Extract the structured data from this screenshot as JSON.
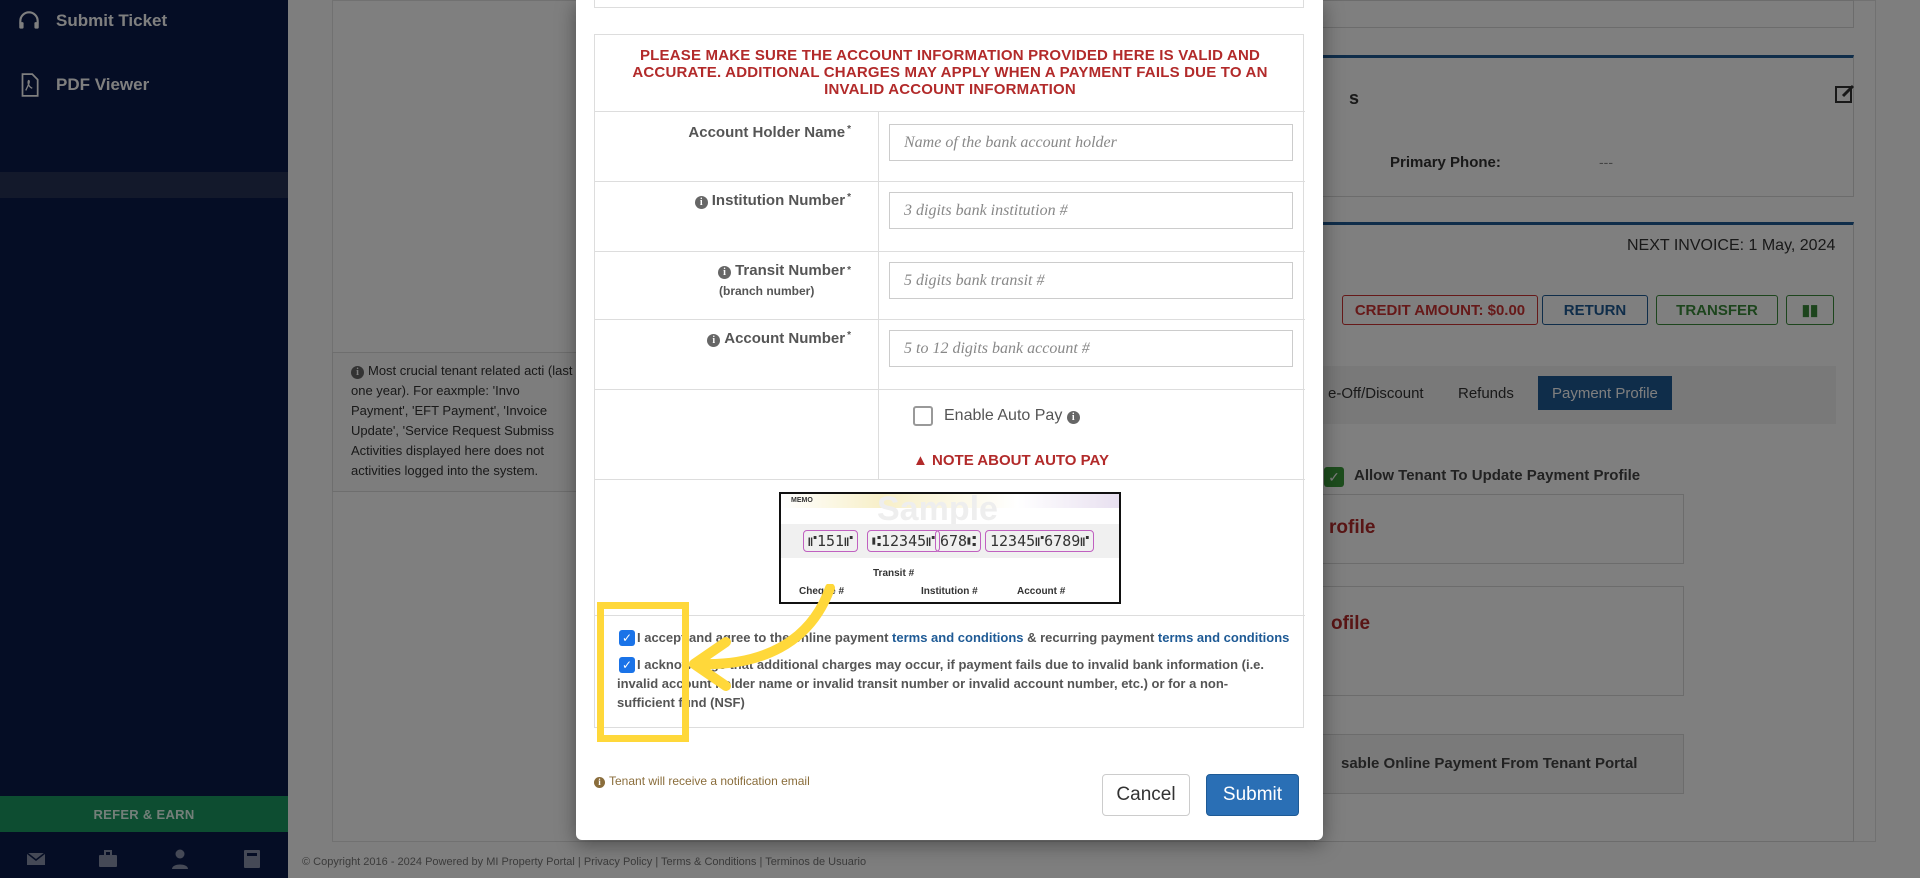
{
  "sidebar": {
    "items": [
      {
        "label": "Submit Ticket",
        "icon": "headset-icon"
      },
      {
        "label": "PDF Viewer",
        "icon": "pdf-icon"
      }
    ],
    "refer_label": "REFER & EARN",
    "bottom_icons": [
      "mail-icon",
      "briefcase-icon",
      "user-icon",
      "calculator-icon"
    ]
  },
  "background": {
    "primary_phone_label": "Primary Phone:",
    "primary_phone_value": "---",
    "next_invoice": "NEXT INVOICE: 1 May, 2024",
    "credit_amount": "CREDIT AMOUNT: $0.00",
    "return_label": "RETURN",
    "transfer_label": "TRANSFER",
    "tabs": [
      "e-Off/Discount",
      "Refunds",
      "Payment Profile"
    ],
    "allow_update_label": "Allow Tenant To Update Payment Profile",
    "profile_heading_1": "rofile",
    "profile_heading_2": "ofile",
    "section_s": "s",
    "disable_online_label": "sable Online Payment From Tenant Portal",
    "note_text": "Most crucial tenant related acti (last one year). For eaxmple: 'Invo Payment', 'EFT Payment', 'Invoice Update', 'Service Request Submiss Activities displayed here does not activities logged into the system.",
    "footer": "© Copyright 2016 - 2024 Powered by MI Property Portal | Privacy Policy | Terms & Conditions | Terminos de Usuario"
  },
  "modal": {
    "warning": "PLEASE MAKE SURE THE ACCOUNT INFORMATION PROVIDED HERE IS VALID AND ACCURATE. ADDITIONAL CHARGES MAY APPLY WHEN A PAYMENT FAILS DUE TO AN INVALID ACCOUNT INFORMATION",
    "fields": [
      {
        "label": "Account Holder Name",
        "placeholder": "Name of the bank account holder"
      },
      {
        "label": "Institution Number",
        "placeholder": "3 digits bank institution #"
      },
      {
        "label": "Transit Number",
        "sub": "(branch number)",
        "placeholder": "5 digits bank transit #"
      },
      {
        "label": "Account Number",
        "placeholder": "5 to 12 digits bank account #"
      }
    ],
    "auto_pay_label": "Enable Auto Pay",
    "auto_pay_note": "NOTE ABOUT AUTO PAY",
    "cheque": {
      "memo": "MEMO",
      "sample": "Sample",
      "cheque_no": "⑈151⑈",
      "transit_no": "⑆12345⑈",
      "institution_no": "678⑆",
      "account_no": "12345⑈6789⑈",
      "label_transit": "Transit #",
      "label_cheque": "Cheque #",
      "label_institution": "Institution #",
      "label_account": "Account #"
    },
    "agree1_pre": "I accept and agree to the online payment",
    "agree1_link1": "terms and conditions",
    "agree1_mid": "& recurring payment",
    "agree1_link2": "terms and conditions",
    "agree2": "I acknowledge that additional charges may occur, if payment fails due to invalid bank information (i.e. invalid account holder name or invalid transit number or invalid account number, etc.) or for a non-sufficient fund (NSF)",
    "notification": "Tenant will receive a notification email",
    "cancel_label": "Cancel",
    "submit_label": "Submit"
  },
  "colors": {
    "sidebar": "#0a1a4a",
    "warning": "#b22a2a",
    "primary": "#1e5a95",
    "highlight": "#ffd83a"
  }
}
